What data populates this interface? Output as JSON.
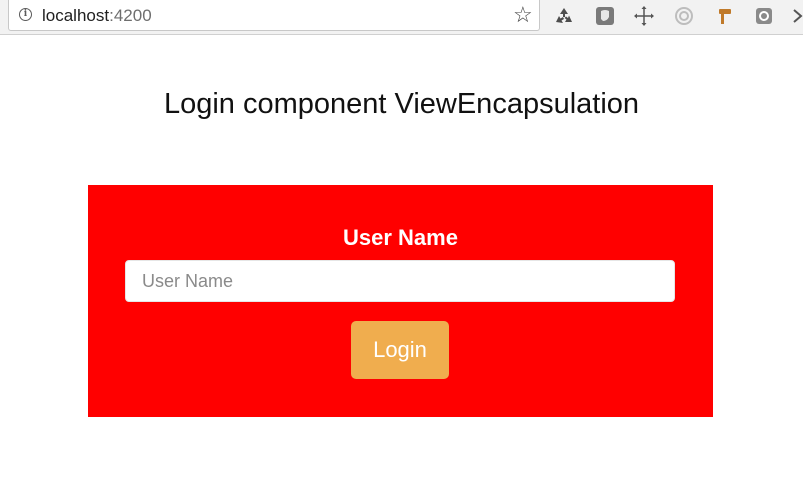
{
  "browser": {
    "url_host": "localhost",
    "url_port": ":4200",
    "icons": [
      "info-icon",
      "star-icon",
      "recycle-icon",
      "shield-icon",
      "move-icon",
      "settings-icon",
      "pin-icon",
      "record-icon"
    ]
  },
  "page": {
    "title": "Login component ViewEncapsulation"
  },
  "login_form": {
    "label": "User Name",
    "input_placeholder": "User Name",
    "input_value": "",
    "button_label": "Login",
    "panel_color": "#ff0000",
    "button_color": "#f0ad4e"
  }
}
